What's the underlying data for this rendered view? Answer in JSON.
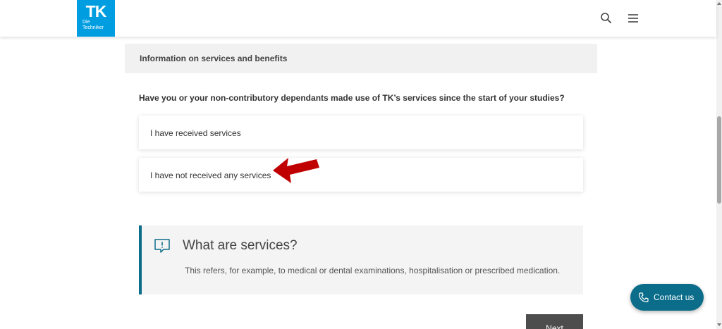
{
  "header": {
    "logo_mark": "TK",
    "logo_brand_line1": "Die",
    "logo_brand_line2": "Techniker",
    "search_icon": "search-icon",
    "menu_icon": "hamburger-menu-icon"
  },
  "section": {
    "title": "Information on services and benefits"
  },
  "question": {
    "text": "Have you or your non-contributory dependants made use of TK’s services since the start of your studies?",
    "options": [
      {
        "label": "I have received services"
      },
      {
        "label": "I have not received any services"
      }
    ]
  },
  "callout": {
    "icon": "speech-bubble-info-icon",
    "title": "What are services?",
    "body": "This refers, for example, to medical or dental examinations, hospitalisation or prescribed medication."
  },
  "actions": {
    "next_label": "Next"
  },
  "contact": {
    "label": "Contact us",
    "icon": "phone-icon"
  },
  "colors": {
    "brand_blue": "#009ee0",
    "accent_teal": "#0b6d8a",
    "next_button": "#4d4d4d",
    "arrow_red": "#c00000"
  }
}
